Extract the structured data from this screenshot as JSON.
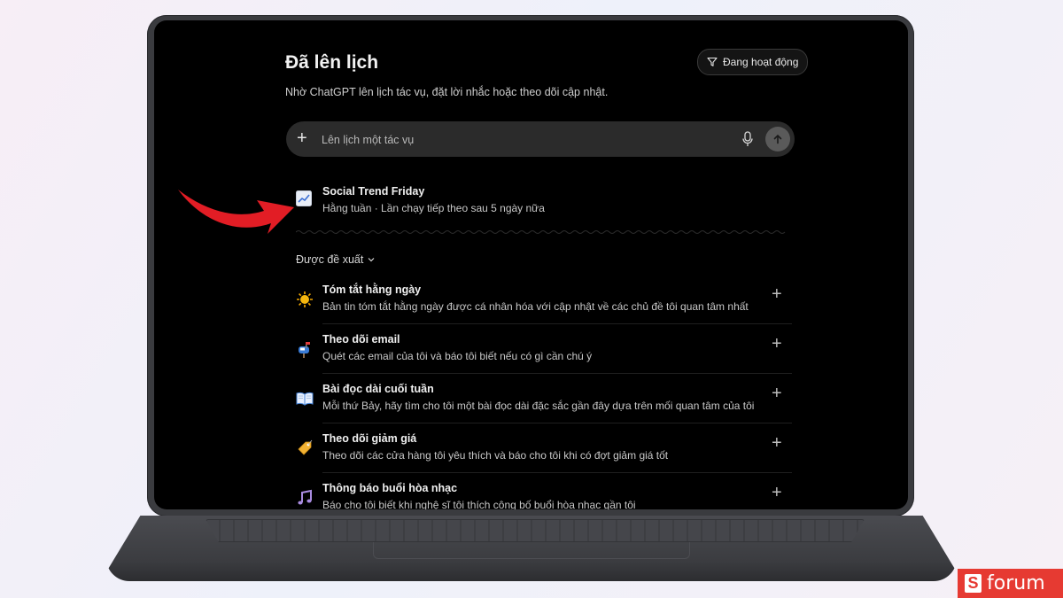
{
  "header": {
    "title": "Đã lên lịch",
    "subtitle": "Nhờ ChatGPT lên lịch tác vụ, đặt lời nhắc hoặc theo dõi cập nhật.",
    "filter_label": "Đang hoạt động"
  },
  "composer": {
    "placeholder": "Lên lịch một tác vụ"
  },
  "scheduled_task": {
    "name": "Social Trend Friday",
    "meta": "Hằng tuần · Lần chạy tiếp theo sau 5 ngày nữa",
    "icon": "chart-increasing-icon"
  },
  "suggested": {
    "heading": "Được đề xuất",
    "items": [
      {
        "title": "Tóm tắt hằng ngày",
        "desc": "Bản tin tóm tắt hằng ngày được cá nhân hóa với cập nhật về các chủ đề tôi quan tâm nhất",
        "icon": "sun-icon"
      },
      {
        "title": "Theo dõi email",
        "desc": "Quét các email của tôi và báo tôi biết nếu có gì cần chú ý",
        "icon": "mailbox-icon"
      },
      {
        "title": "Bài đọc dài cuối tuần",
        "desc": "Mỗi thứ Bảy, hãy tìm cho tôi một bài đọc dài đặc sắc gần đây dựa trên mối quan tâm của tôi",
        "icon": "open-book-icon"
      },
      {
        "title": "Theo dõi giảm giá",
        "desc": "Theo dõi các cửa hàng tôi yêu thích và báo cho tôi khi có đợt giảm giá tốt",
        "icon": "price-tag-icon"
      },
      {
        "title": "Thông báo buổi hòa nhạc",
        "desc": "Báo cho tôi biết khi nghệ sĩ tôi thích công bố buổi hòa nhạc gần tôi",
        "icon": "music-notes-icon"
      }
    ]
  },
  "brand": {
    "logo_letter": "S",
    "name": "forum"
  },
  "colors": {
    "screen_bg": "#000000",
    "composer_bg": "#2b2b2b",
    "arrow": "#e21d25",
    "brand": "#e63a32"
  }
}
